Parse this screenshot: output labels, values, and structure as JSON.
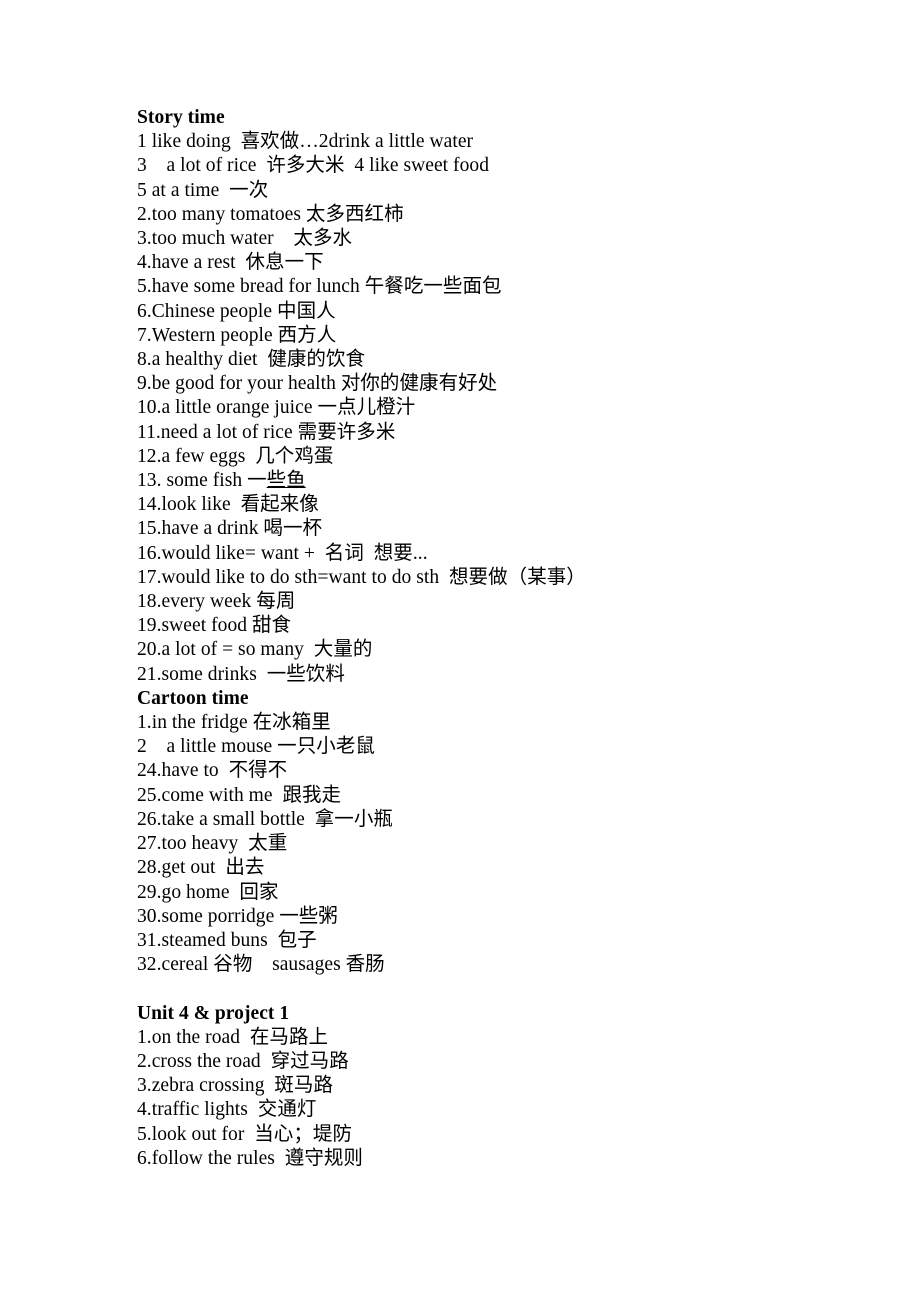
{
  "document": {
    "sections": [
      {
        "heading": "Story time",
        "lines": [
          "1 like doing  喜欢做…2drink a little water",
          "3    a lot of rice  许多大米  4 like sweet food",
          "5 at a time  一次",
          "2.too many tomatoes 太多西红柿",
          "3.too much water    太多水",
          "4.have a rest  休息一下",
          "5.have some bread for lunch 午餐吃一些面包",
          "6.Chinese people 中国人",
          "7.Western people 西方人",
          "8.a healthy diet  健康的饮食",
          "9.be good for your health 对你的健康有好处",
          "10.a little orange juice 一点儿橙汁",
          "11.need a lot of rice 需要许多米",
          "12.a few eggs  几个鸡蛋",
          "13. some fish 一些鱼",
          "14.look like  看起来像",
          "15.have a drink 喝一杯",
          "16.would like= want +  名词  想要...",
          "17.would like to do sth=want to do sth  想要做（某事）",
          "18.every week 每周",
          "19.sweet food 甜食",
          "20.a lot of = so many  大量的",
          "21.some drinks  一些饮料"
        ]
      },
      {
        "heading": "Cartoon time",
        "lines": [
          "1.in the fridge 在冰箱里",
          "2    a little mouse 一只小老鼠",
          "24.have to  不得不",
          "25.come with me  跟我走",
          "26.take a small bottle  拿一小瓶",
          "27.too heavy  太重",
          "28.get out  出去",
          "29.go home  回家",
          "30.some porridge 一些粥",
          "31.steamed buns  包子",
          "32.cereal 谷物    sausages 香肠"
        ]
      },
      {
        "heading": "Unit 4 & project 1",
        "lines": [
          "1.on the road  在马路上",
          "2.cross the road  穿过马路",
          "3.zebra crossing  斑马路",
          "4.traffic lights  交通灯",
          "5.look out for  当心；堤防",
          "6.follow the rules  遵守规则"
        ]
      }
    ],
    "underlined_line": {
      "index": 14,
      "section": 0,
      "prefix": "13. some fish 一",
      "underlined": "些鱼"
    }
  }
}
